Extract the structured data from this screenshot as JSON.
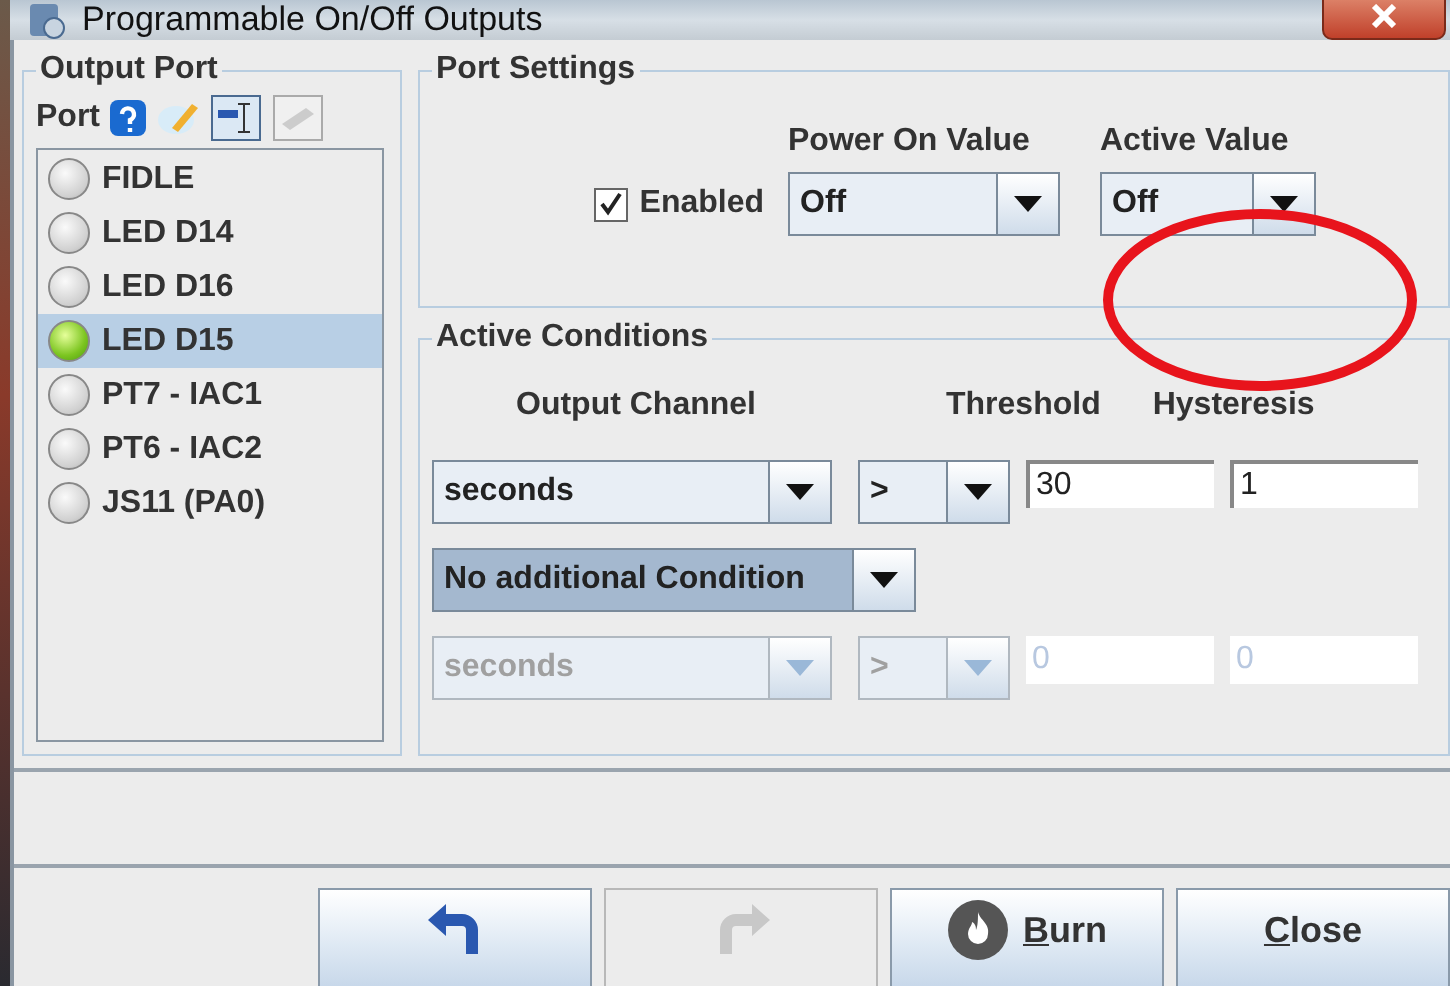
{
  "window": {
    "title": "Programmable On/Off Outputs"
  },
  "output_port": {
    "title": "Output Port",
    "port_label": "Port",
    "items": [
      {
        "label": "FIDLE",
        "on": false,
        "selected": false
      },
      {
        "label": "LED D14",
        "on": false,
        "selected": false
      },
      {
        "label": "LED D16",
        "on": false,
        "selected": false
      },
      {
        "label": "LED D15",
        "on": true,
        "selected": true
      },
      {
        "label": "PT7 - IAC1",
        "on": false,
        "selected": false
      },
      {
        "label": "PT6 - IAC2",
        "on": false,
        "selected": false
      },
      {
        "label": "JS11 (PA0)",
        "on": false,
        "selected": false
      }
    ]
  },
  "port_settings": {
    "title": "Port Settings",
    "enabled": {
      "label": "Enabled",
      "checked": true
    },
    "power_on": {
      "label": "Power On Value",
      "value": "Off"
    },
    "active": {
      "label": "Active Value",
      "value": "Off"
    }
  },
  "active_conditions": {
    "title": "Active Conditions",
    "headers": [
      "Output Channel",
      "Threshold",
      "Hysteresis"
    ],
    "rows": [
      {
        "channel": "seconds",
        "operator": ">",
        "threshold": "30",
        "hysteresis": "1",
        "disabled": false
      },
      {
        "channel": "seconds",
        "operator": ">",
        "threshold": "0",
        "hysteresis": "0",
        "disabled": true
      }
    ],
    "additional": {
      "value": "No additional Condition"
    }
  },
  "buttons": [
    {
      "kind": "undo",
      "disabled": false
    },
    {
      "kind": "redo",
      "disabled": true
    },
    {
      "kind": "burn",
      "label": "Burn",
      "disabled": false
    },
    {
      "kind": "close",
      "label": "Close",
      "disabled": false
    }
  ]
}
